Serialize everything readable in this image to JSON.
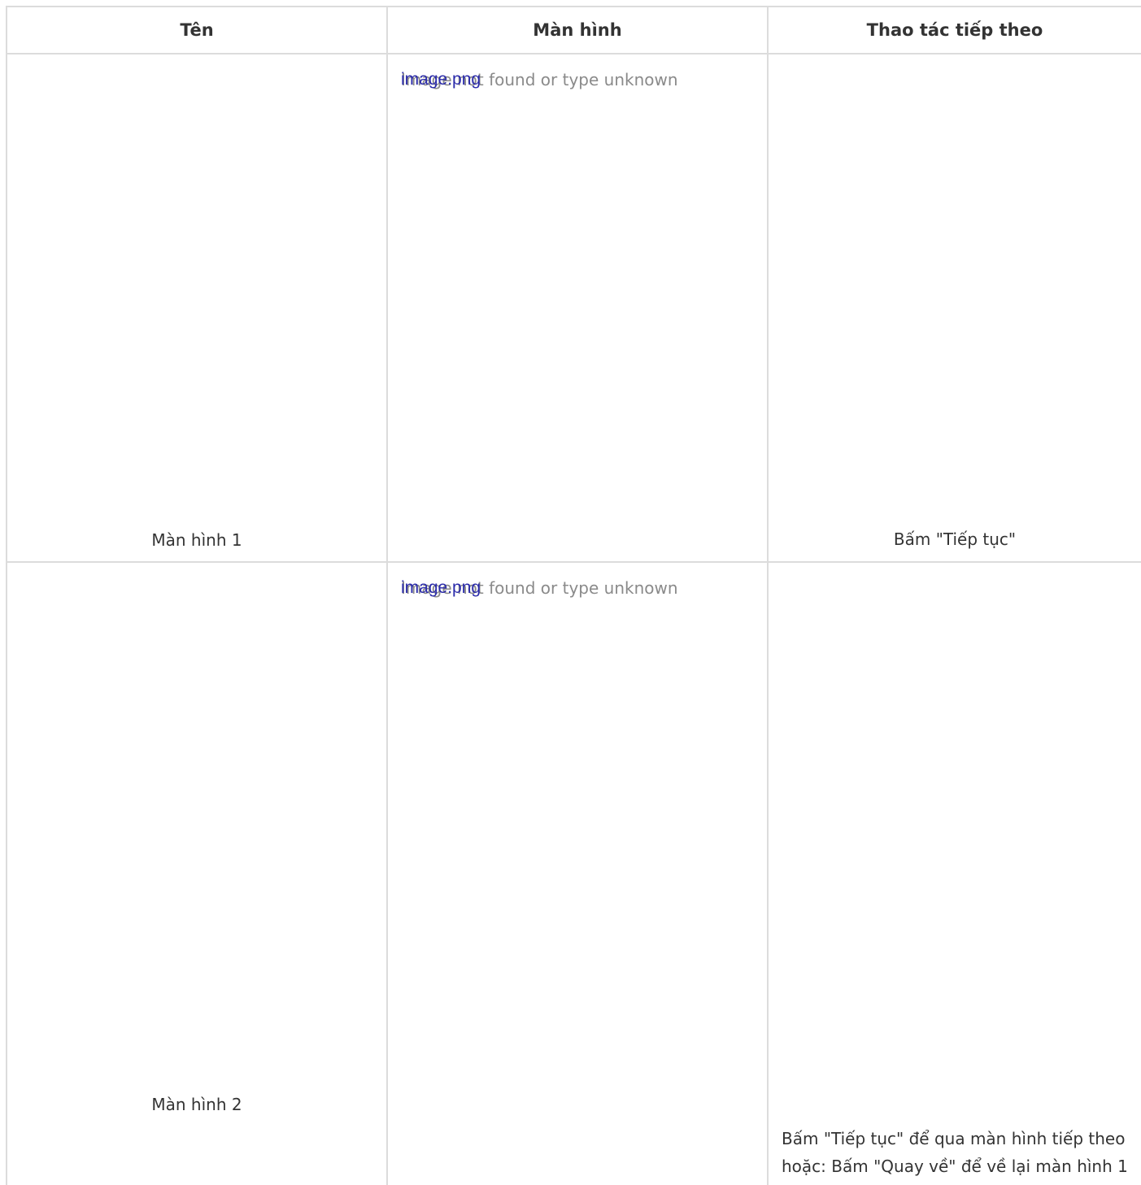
{
  "table": {
    "headers": {
      "name": "Tên",
      "screen": "Màn hình",
      "next_action": "Thao tác tiếp theo"
    },
    "rows": [
      {
        "name": "Màn hình 1",
        "image_link": "image.png",
        "image_alt": "Image not found or type unknown",
        "next_action": "Bấm \"Tiếp tục\""
      },
      {
        "name": "Màn hình 2",
        "image_link": "image.png",
        "image_alt": "Image not found or type unknown",
        "next_action": "Bấm \"Tiếp tục\" để qua màn hình tiếp theo hoặc: Bấm \"Quay về\" để về lại màn hình 1"
      }
    ]
  }
}
